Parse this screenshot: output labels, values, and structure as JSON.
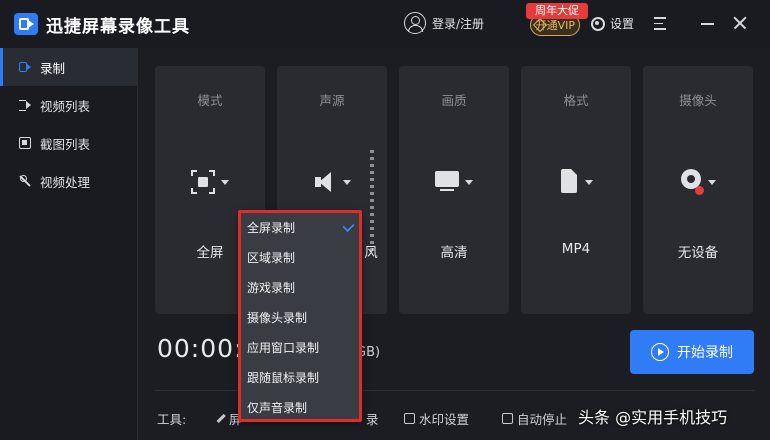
{
  "app": {
    "title": "迅捷屏幕录像工具"
  },
  "header": {
    "login_label": "登录/注册",
    "vip_label": "开通VIP",
    "vip_badge": "周年大促",
    "settings_label": "设置"
  },
  "sidebar": {
    "items": [
      {
        "label": "录制",
        "icon": "record-icon",
        "active": true
      },
      {
        "label": "视频列表",
        "icon": "video-list-icon",
        "active": false
      },
      {
        "label": "截图列表",
        "icon": "screenshot-list-icon",
        "active": false
      },
      {
        "label": "视频处理",
        "icon": "video-process-icon",
        "active": false
      }
    ]
  },
  "cards": [
    {
      "title": "模式",
      "value": "全屏",
      "icon": "fullscreen-icon"
    },
    {
      "title": "声源",
      "value": "风",
      "icon": "speaker-icon"
    },
    {
      "title": "画质",
      "value": "高清",
      "icon": "monitor-icon"
    },
    {
      "title": "格式",
      "value": "MP4",
      "icon": "file-icon"
    },
    {
      "title": "摄像头",
      "value": "无设备",
      "icon": "camera-icon"
    }
  ],
  "timer": {
    "value": "00:00:",
    "size_suffix": "GB)"
  },
  "record": {
    "start_label": "开始录制"
  },
  "tools": {
    "label": "工具:",
    "items": [
      {
        "label": "屏",
        "icon": "pen-icon"
      },
      {
        "label": "录",
        "icon": "none"
      },
      {
        "label": "水印设置",
        "icon": "watermark-icon"
      },
      {
        "label": "自动停止",
        "icon": "auto-stop-icon"
      }
    ]
  },
  "mode_dropdown": {
    "options": [
      "全屏录制",
      "区域录制",
      "游戏录制",
      "摄像头录制",
      "应用窗口录制",
      "跟随鼠标录制",
      "仅声音录制"
    ],
    "selected_index": 0
  },
  "watermark": {
    "text": "头条 @实用手机技巧"
  },
  "colors": {
    "accent": "#2f7cf6",
    "highlight_border": "#e02b2b",
    "vip_gold": "#e8b768"
  }
}
